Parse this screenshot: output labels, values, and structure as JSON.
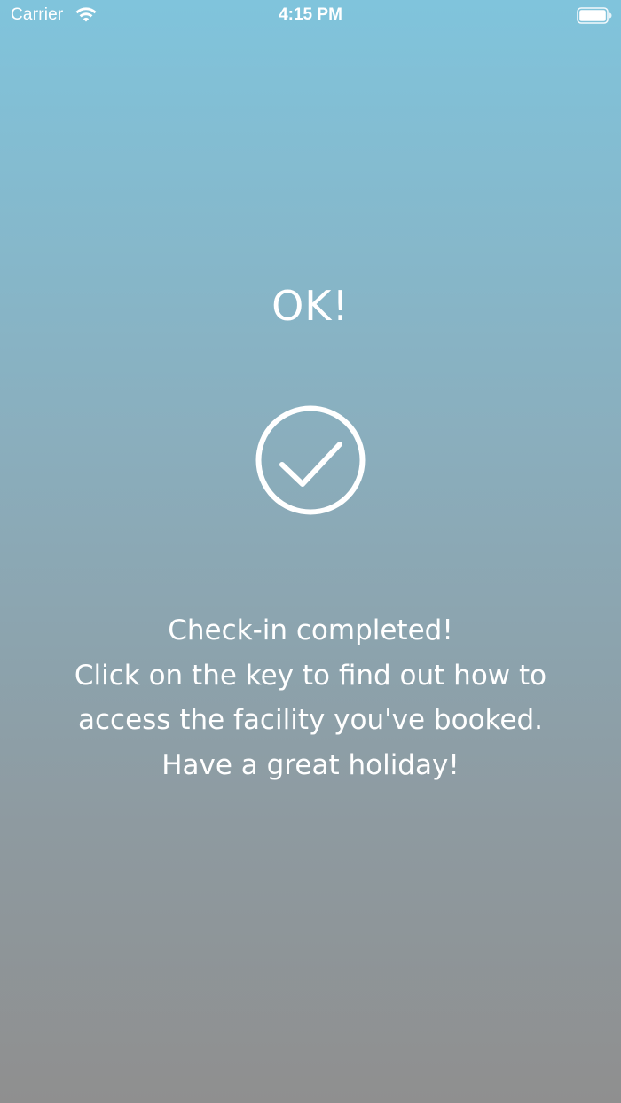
{
  "status_bar": {
    "carrier": "Carrier",
    "time": "4:15 PM",
    "wifi_icon": "wifi-icon",
    "battery_icon": "battery-full-icon"
  },
  "content": {
    "title": "OK!",
    "check_icon": "check-circle-icon",
    "message_lines": [
      "Check-in completed!",
      "Click on the key to find out how to",
      "access the facility you've booked.",
      "Have a great holiday!"
    ]
  },
  "colors": {
    "gradient_top": "#80c4dc",
    "gradient_bottom": "#8f8f8f",
    "foreground": "#ffffff"
  }
}
